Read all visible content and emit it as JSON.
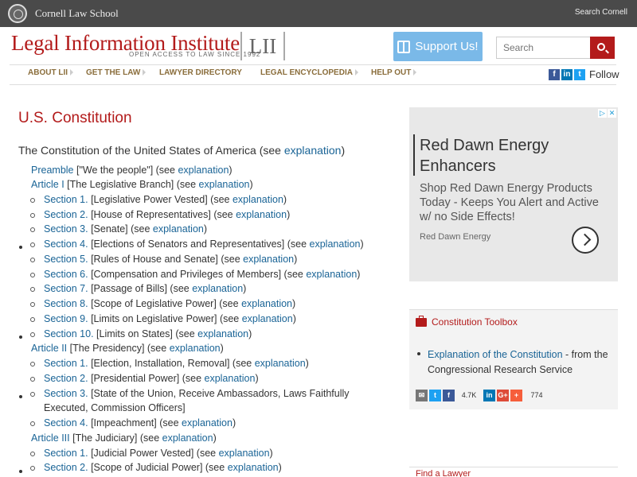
{
  "cornell": {
    "name": "Cornell Law School",
    "search_link": "Search Cornell"
  },
  "header": {
    "title": "Legal Information Institute",
    "tagline": "OPEN ACCESS TO LAW SINCE 1992",
    "logo": "LII",
    "support_label": "Support Us!",
    "search_placeholder": "Search"
  },
  "nav": {
    "items": [
      {
        "label": "ABOUT LII"
      },
      {
        "label": "GET THE LAW"
      },
      {
        "label": "LAWYER DIRECTORY"
      },
      {
        "label": "LEGAL ENCYCLOPEDIA"
      },
      {
        "label": "HELP OUT"
      }
    ],
    "follow_label": "Follow"
  },
  "main": {
    "title": "U.S. Constitution",
    "intro_text": "The Constitution of the United States of America (see ",
    "intro_link": "explanation",
    "intro_end": ")",
    "toc": [
      {
        "link": "Preamble",
        "text": " [\"We the people\"] (see ",
        "expl": "explanation",
        "end": ")"
      },
      {
        "link": "Article I",
        "text": " [The Legislative Branch] (see ",
        "expl": "explanation",
        "end": ")"
      },
      {
        "link": "Section 1.",
        "text": " [Legislative Power Vested] (see ",
        "expl": "explanation",
        "end": ")"
      },
      {
        "link": "Section 2.",
        "text": " [House of Representatives] (see ",
        "expl": "explanation",
        "end": ")"
      },
      {
        "link": "Section 3.",
        "text": " [Senate] (see ",
        "expl": "explanation",
        "end": ")"
      },
      {
        "link": "Section 4.",
        "text": " [Elections of Senators and Representatives] (see ",
        "expl": "explanation",
        "end": ")"
      },
      {
        "link": "Section 5.",
        "text": " [Rules of House and Senate] (see ",
        "expl": "explanation",
        "end": ")"
      },
      {
        "link": "Section 6.",
        "text": " [Compensation and Privileges of Members] (see ",
        "expl": "explanation",
        "end": ")"
      },
      {
        "link": "Section 7.",
        "text": " [Passage of Bills] (see ",
        "expl": "explanation",
        "end": ")"
      },
      {
        "link": "Section 8.",
        "text": " [Scope of Legislative Power] (see ",
        "expl": "explanation",
        "end": ")"
      },
      {
        "link": "Section 9.",
        "text": " [Limits on Legislative Power] (see ",
        "expl": "explanation",
        "end": ")"
      },
      {
        "link": "Section 10.",
        "text": " [Limits on States] (see ",
        "expl": "explanation",
        "end": ")"
      },
      {
        "link": "Article II",
        "text": " [The Presidency] (see ",
        "expl": "explanation",
        "end": ")"
      },
      {
        "link": "Section 1.",
        "text": " [Election, Installation, Removal] (see ",
        "expl": "explanation",
        "end": ")"
      },
      {
        "link": "Section 2.",
        "text": " [Presidential Power] (see ",
        "expl": "explanation",
        "end": ")"
      },
      {
        "link": "Section 3.",
        "text": " [State of the Union, Receive Ambassadors, Laws Faithfully",
        "text2": "Executed, Commission Officers]"
      },
      {
        "link": "Section 4.",
        "text": " [Impeachment] (see ",
        "expl": "explanation",
        "end": ")"
      },
      {
        "link": "Article III",
        "text": " [The Judiciary] (see ",
        "expl": "explanation",
        "end": ")"
      },
      {
        "link": "Section 1.",
        "text": " [Judicial Power Vested] (see ",
        "expl": "explanation",
        "end": ")"
      },
      {
        "link": "Section 2.",
        "text": " [Scope of Judicial Power] (see ",
        "expl": "explanation",
        "end": ")"
      }
    ]
  },
  "ad": {
    "headline": "Red Dawn Energy Enhancers",
    "body": "Shop Red Dawn Energy Products Today - Keeps You Alert and Active w/ no Side Effects!",
    "source": "Red Dawn Energy",
    "choices_1": "▷",
    "choices_2": "✕"
  },
  "toolbox": {
    "title": "Constitution Toolbox",
    "item_link": "Explanation of the Constitution",
    "item_text": " - from the Congressional Research Service",
    "share_count_1": "4.7K",
    "share_count_2": "774"
  },
  "find_lawyer": {
    "title": "Find a Lawyer"
  },
  "colors": {
    "accent": "#b31b1b",
    "link": "#1a6496",
    "support": "#7ab9e8"
  }
}
